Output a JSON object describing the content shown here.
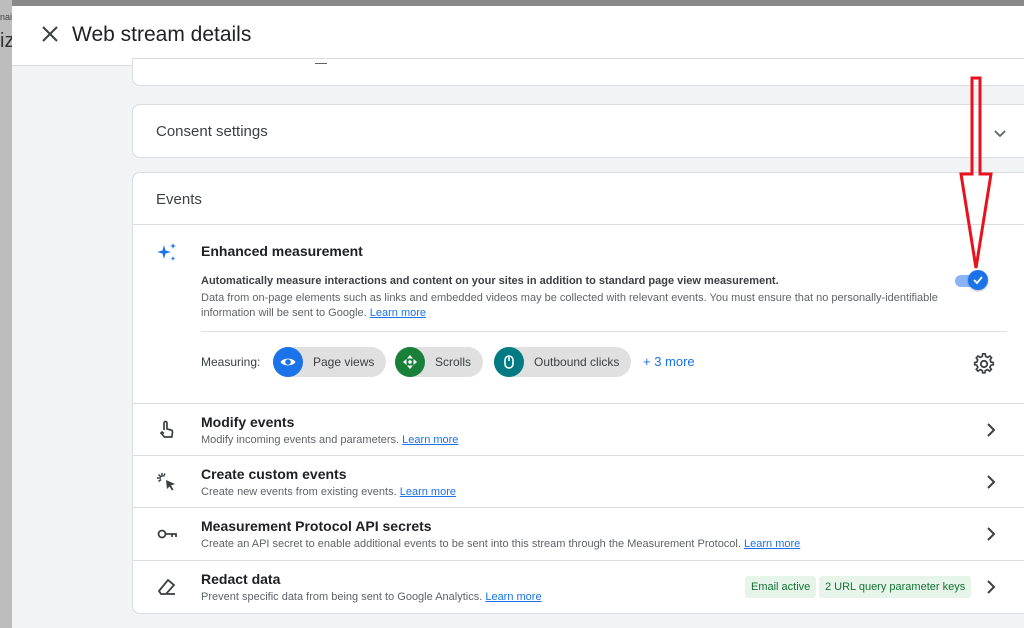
{
  "backdrop": {
    "line1": "nai",
    "line2": "iz"
  },
  "header": {
    "title": "Web stream details"
  },
  "consent": {
    "label": "Consent settings"
  },
  "events": {
    "label": "Events",
    "enhanced": {
      "title": "Enhanced measurement",
      "desc_bold": "Automatically measure interactions and content on your sites in addition to standard page view measurement.",
      "desc": "Data from on-page elements such as links and embedded videos may be collected with relevant events. You must ensure that no personally-identifiable information will be sent to Google.",
      "learn_more": "Learn more",
      "toggle_on": true
    },
    "measuring": {
      "label": "Measuring:",
      "chips": [
        {
          "label": "Page views",
          "icon": "eye-icon",
          "color": "#1a73e8"
        },
        {
          "label": "Scrolls",
          "icon": "scroll-icon",
          "color": "#188038"
        },
        {
          "label": "Outbound clicks",
          "icon": "mouse-icon",
          "color": "#007b83"
        }
      ],
      "more": "+ 3 more"
    },
    "rows": [
      {
        "title": "Modify events",
        "desc": "Modify incoming events and parameters.",
        "learn_more": "Learn more",
        "icon": "touch-icon"
      },
      {
        "title": "Create custom events",
        "desc": "Create new events from existing events.",
        "learn_more": "Learn more",
        "icon": "click-sparkle-icon"
      },
      {
        "title": "Measurement Protocol API secrets",
        "desc": "Create an API secret to enable additional events to be sent into this stream through the Measurement Protocol.",
        "learn_more": "Learn more",
        "icon": "key-icon"
      },
      {
        "title": "Redact data",
        "desc": "Prevent specific data from being sent to Google Analytics.",
        "learn_more": "Learn more",
        "icon": "eraser-icon",
        "badges": [
          "Email active",
          "2 URL query parameter keys"
        ]
      }
    ]
  },
  "colors": {
    "accent": "#1a73e8",
    "annotation": "#e8121c",
    "badge_bg": "#e6f4ea",
    "badge_text": "#137333"
  }
}
